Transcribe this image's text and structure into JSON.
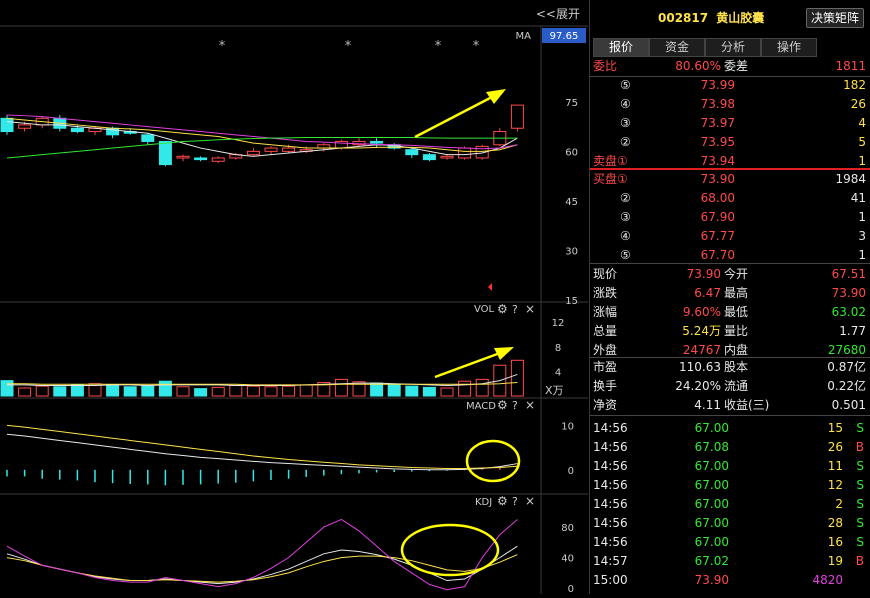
{
  "toolbar": {
    "expand_label": "<<展开"
  },
  "price_panel": {
    "ma_label": "MA",
    "current_price_badge": "97.65",
    "axis_ticks": [
      "75",
      "60",
      "45",
      "30",
      "15"
    ],
    "markers": [
      "*",
      "*",
      "*",
      "*"
    ]
  },
  "vol_panel": {
    "label": "VOL",
    "axis_ticks": [
      "12",
      "8",
      "4"
    ],
    "unit": "X万",
    "gear": "⚙",
    "help": "?",
    "close": "×"
  },
  "macd_panel": {
    "label": "MACD",
    "axis_ticks": [
      "10",
      "0"
    ],
    "gear": "⚙",
    "help": "?",
    "close": "×"
  },
  "kdj_panel": {
    "label": "KDJ",
    "axis_ticks": [
      "80",
      "40",
      "0"
    ],
    "gear": "⚙",
    "help": "?",
    "close": "×"
  },
  "header": {
    "code": "002817",
    "name": "黄山胶囊",
    "matrix_button": "决策矩阵"
  },
  "tabs": [
    {
      "label": "报价"
    },
    {
      "label": "资金"
    },
    {
      "label": "分析"
    },
    {
      "label": "操作"
    }
  ],
  "order_ratio": {
    "label1": "委比",
    "value1": "80.60%",
    "label2": "委差",
    "value2": "1811"
  },
  "sell_orders": [
    {
      "label": "⑤",
      "price": "73.99",
      "volume": "182"
    },
    {
      "label": "④",
      "price": "73.98",
      "volume": "26"
    },
    {
      "label": "③",
      "price": "73.97",
      "volume": "4"
    },
    {
      "label": "②",
      "price": "73.95",
      "volume": "5"
    },
    {
      "label": "卖盘①",
      "price": "73.94",
      "volume": "1"
    }
  ],
  "buy_orders": [
    {
      "label": "买盘①",
      "price": "73.90",
      "volume": "1984"
    },
    {
      "label": "②",
      "price": "68.00",
      "volume": "41"
    },
    {
      "label": "③",
      "price": "67.90",
      "volume": "1"
    },
    {
      "label": "④",
      "price": "67.77",
      "volume": "3"
    },
    {
      "label": "⑤",
      "price": "67.70",
      "volume": "1"
    }
  ],
  "quote": [
    {
      "l1": "现价",
      "v1": "73.90",
      "l2": "今开",
      "v2": "67.51"
    },
    {
      "l1": "涨跌",
      "v1": "6.47",
      "l2": "最高",
      "v2": "73.90"
    },
    {
      "l1": "涨幅",
      "v1": "9.60%",
      "l2": "最低",
      "v2": "63.02"
    },
    {
      "l1": "总量",
      "v1": "5.24万",
      "l2": "量比",
      "v2": "1.77"
    },
    {
      "l1": "外盘",
      "v1": "24767",
      "l2": "内盘",
      "v2": "27680"
    }
  ],
  "fundamentals": [
    {
      "l1": "市盈",
      "v1": "110.63",
      "l2": "股本",
      "v2": "0.87亿"
    },
    {
      "l1": "换手",
      "v1": "24.20%",
      "l2": "流通",
      "v2": "0.22亿"
    },
    {
      "l1": "净资",
      "v1": "4.11",
      "l2": "收益(三)",
      "v2": "0.501"
    }
  ],
  "trades": [
    {
      "time": "14:56",
      "price": "67.00",
      "volume": "15",
      "side": "S"
    },
    {
      "time": "14:56",
      "price": "67.08",
      "volume": "26",
      "side": "B"
    },
    {
      "time": "14:56",
      "price": "67.00",
      "volume": "11",
      "side": "S"
    },
    {
      "time": "14:56",
      "price": "67.00",
      "volume": "12",
      "side": "S"
    },
    {
      "time": "14:56",
      "price": "67.00",
      "volume": "2",
      "side": "S"
    },
    {
      "time": "14:56",
      "price": "67.00",
      "volume": "28",
      "side": "S"
    },
    {
      "time": "14:56",
      "price": "67.00",
      "volume": "16",
      "side": "S"
    },
    {
      "time": "14:57",
      "price": "67.02",
      "volume": "19",
      "side": "B"
    },
    {
      "time": "15:00",
      "price": "73.90",
      "volume": "4820",
      "side": ""
    }
  ],
  "colors": {
    "up": "#ff4a4a",
    "down": "#33e8e8",
    "ma5": "#e8e8e8",
    "ma10": "#ffe24a",
    "ma20": "#e040e0",
    "ma60": "#33e833",
    "annotation": "#ffff00"
  },
  "chart_data": {
    "type": "candlestick",
    "price_ylim": [
      15,
      97.65
    ],
    "candles": [
      {
        "o": 70,
        "c": 66,
        "h": 71,
        "l": 65
      },
      {
        "o": 67,
        "c": 68,
        "h": 69,
        "l": 66
      },
      {
        "o": 68,
        "c": 70,
        "h": 70.5,
        "l": 67
      },
      {
        "o": 70,
        "c": 67,
        "h": 71,
        "l": 66
      },
      {
        "o": 67,
        "c": 66,
        "h": 68,
        "l": 65.5
      },
      {
        "o": 66,
        "c": 67,
        "h": 67.5,
        "l": 65
      },
      {
        "o": 67,
        "c": 65,
        "h": 67.5,
        "l": 64
      },
      {
        "o": 66,
        "c": 65.5,
        "h": 67,
        "l": 65
      },
      {
        "o": 65,
        "c": 63,
        "h": 65.5,
        "l": 62
      },
      {
        "o": 63,
        "c": 56,
        "h": 63,
        "l": 55.5
      },
      {
        "o": 58,
        "c": 58.5,
        "h": 59,
        "l": 57
      },
      {
        "o": 58,
        "c": 57.5,
        "h": 58.5,
        "l": 57
      },
      {
        "o": 57,
        "c": 58,
        "h": 58.5,
        "l": 56.5
      },
      {
        "o": 58,
        "c": 59,
        "h": 59.5,
        "l": 57.5
      },
      {
        "o": 59,
        "c": 60,
        "h": 61,
        "l": 58.5
      },
      {
        "o": 60,
        "c": 61,
        "h": 61.5,
        "l": 59
      },
      {
        "o": 60,
        "c": 61,
        "h": 62,
        "l": 59.5
      },
      {
        "o": 60,
        "c": 60.5,
        "h": 61.5,
        "l": 59.5
      },
      {
        "o": 61,
        "c": 62,
        "h": 62.5,
        "l": 60
      },
      {
        "o": 61,
        "c": 63,
        "h": 63.5,
        "l": 60.5
      },
      {
        "o": 62,
        "c": 63,
        "h": 64,
        "l": 61.5
      },
      {
        "o": 63,
        "c": 62.5,
        "h": 64,
        "l": 61
      },
      {
        "o": 62,
        "c": 61,
        "h": 62.5,
        "l": 60.5
      },
      {
        "o": 60.5,
        "c": 59,
        "h": 61,
        "l": 58
      },
      {
        "o": 59,
        "c": 57.5,
        "h": 59.5,
        "l": 57
      },
      {
        "o": 58,
        "c": 58.5,
        "h": 59,
        "l": 57.5
      },
      {
        "o": 58,
        "c": 61,
        "h": 61.5,
        "l": 57.5
      },
      {
        "o": 58,
        "c": 61.5,
        "h": 62,
        "l": 57.5
      },
      {
        "o": 62,
        "c": 66,
        "h": 67,
        "l": 61.5
      },
      {
        "o": 67,
        "c": 74,
        "h": 74,
        "l": 66
      }
    ],
    "ma": [
      {
        "name": "MA5",
        "values": [
          69,
          68.5,
          68,
          68,
          67.5,
          67,
          66.5,
          66,
          65.5,
          64,
          62.5,
          61,
          60,
          59,
          58.5,
          59,
          59.5,
          60,
          60.5,
          61,
          61.5,
          62,
          61.8,
          61,
          60,
          59,
          59,
          59.5,
          61,
          64
        ]
      },
      {
        "name": "MA10",
        "values": [
          70,
          69.5,
          69,
          68.5,
          68,
          67.5,
          67,
          66.8,
          66.5,
          66,
          65.5,
          65,
          64.5,
          63.5,
          62.5,
          62,
          61.5,
          61,
          61,
          61,
          61,
          61.2,
          61.3,
          61.2,
          61,
          60.5,
          60,
          60,
          60.5,
          62
        ]
      },
      {
        "name": "MA20",
        "values": [
          71,
          70.8,
          70.5,
          70,
          69.5,
          69,
          68.5,
          68,
          67.5,
          67,
          66.5,
          66,
          65.5,
          65,
          64.5,
          64,
          63.5,
          63,
          62.8,
          62.5,
          62.3,
          62.1,
          62,
          61.8,
          61.5,
          61.2,
          61,
          60.8,
          61,
          62
        ]
      },
      {
        "name": "MA60",
        "values": [
          58,
          58.5,
          59,
          59.5,
          60,
          60.5,
          61,
          61.5,
          62,
          62.5,
          63,
          63.2,
          63.5,
          63.7,
          63.9,
          64,
          64.1,
          64.2,
          64.2,
          64.2,
          64.2,
          64.2,
          64.2,
          64.2,
          64.1,
          64,
          64,
          64,
          64,
          64
        ]
      }
    ],
    "vol_ylim": [
      0,
      13
    ],
    "volumes": [
      2.5,
      1.3,
      1.6,
      1.5,
      1.8,
      2,
      1.7,
      1.5,
      1.6,
      2.4,
      1.5,
      1.2,
      1.4,
      1.7,
      1.6,
      1.5,
      1.6,
      1.8,
      2.2,
      2.7,
      2.3,
      2.1,
      1.9,
      1.6,
      1.4,
      1.3,
      2.4,
      2.7,
      5,
      5.8
    ],
    "vol_ma": [
      {
        "name": "MAVOL1",
        "values": [
          1.8,
          1.8,
          1.7,
          1.7,
          1.7,
          1.7,
          1.8,
          1.8,
          1.7,
          1.8,
          1.8,
          1.8,
          1.8,
          1.7,
          1.7,
          1.7,
          1.7,
          1.8,
          1.9,
          2,
          2.1,
          2.1,
          2,
          1.9,
          1.8,
          1.7,
          1.8,
          2,
          2.5,
          3.5
        ]
      },
      {
        "name": "MAVOL2",
        "values": [
          2,
          2,
          1.9,
          1.9,
          1.9,
          1.9,
          1.9,
          1.9,
          1.9,
          1.9,
          1.9,
          1.9,
          1.9,
          1.9,
          1.8,
          1.8,
          1.8,
          1.8,
          1.8,
          1.9,
          1.9,
          1.9,
          1.9,
          1.9,
          1.9,
          1.9,
          1.9,
          1.9,
          2,
          2.2
        ]
      }
    ],
    "macd_ylim": [
      -5,
      13
    ],
    "macd_hist": [
      -1.5,
      -1.5,
      -2,
      -2.2,
      -2.4,
      -2.8,
      -3,
      -3.2,
      -3.3,
      -3.5,
      -3.4,
      -3.3,
      -3.1,
      -2.9,
      -2.6,
      -2.3,
      -2,
      -1.6,
      -1.3,
      -1,
      -0.8,
      -0.6,
      -0.5,
      -0.4,
      -0.3,
      -0.2,
      -0.1,
      0.3,
      0.6,
      1.1
    ],
    "macd_dif": [
      8,
      7.6,
      7.1,
      6.6,
      6.1,
      5.6,
      5.1,
      4.6,
      4.1,
      3.6,
      3.2,
      2.8,
      2.5,
      2.2,
      1.9,
      1.6,
      1.4,
      1.2,
      1,
      0.8,
      0.6,
      0.4,
      0.2,
      0.1,
      0,
      0,
      0.1,
      0.3,
      0.7,
      1.4
    ],
    "macd_dea": [
      10,
      9.6,
      9.1,
      8.6,
      8.1,
      7.6,
      7.1,
      6.6,
      6.1,
      5.6,
      5.1,
      4.6,
      4.1,
      3.6,
      3.1,
      2.7,
      2.3,
      2,
      1.7,
      1.4,
      1.1,
      0.9,
      0.7,
      0.5,
      0.4,
      0.3,
      0.3,
      0.4,
      0.5,
      0.8
    ],
    "kdj_ylim": [
      -5,
      105
    ],
    "kdj_k": [
      45,
      38,
      30,
      25,
      20,
      15,
      12,
      10,
      10,
      12,
      10,
      8,
      6,
      8,
      12,
      18,
      25,
      35,
      45,
      50,
      48,
      44,
      38,
      30,
      20,
      10,
      12,
      25,
      40,
      55
    ],
    "kdj_d": [
      40,
      36,
      30,
      25,
      20,
      16,
      13,
      10,
      10,
      11,
      10,
      9,
      8,
      9,
      11,
      15,
      20,
      28,
      35,
      40,
      42,
      42,
      40,
      36,
      30,
      24,
      22,
      26,
      34,
      44
    ],
    "kdj_j": [
      55,
      42,
      30,
      25,
      20,
      14,
      10,
      8,
      8,
      14,
      10,
      6,
      2,
      6,
      14,
      26,
      40,
      60,
      80,
      90,
      75,
      55,
      35,
      20,
      5,
      -2,
      2,
      40,
      70,
      90
    ]
  }
}
